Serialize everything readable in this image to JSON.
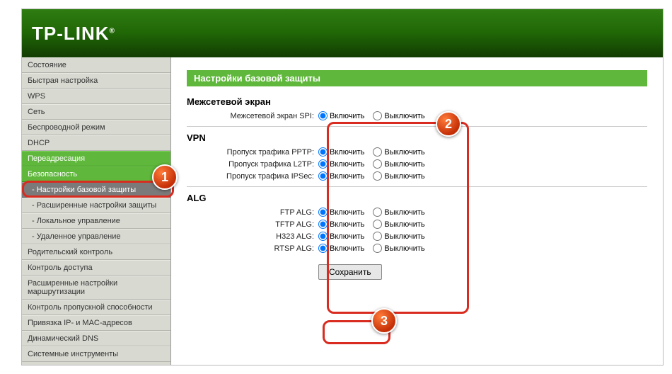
{
  "brand": "TP-LINK",
  "page_title": "Настройки базовой защиты",
  "nav": [
    {
      "label": "Состояние"
    },
    {
      "label": "Быстрая настройка"
    },
    {
      "label": "WPS"
    },
    {
      "label": "Сеть"
    },
    {
      "label": "Беспроводной режим"
    },
    {
      "label": "DHCP"
    },
    {
      "label": "Переадресация",
      "accent": true
    },
    {
      "label": "Безопасность",
      "accent": true
    },
    {
      "label": "- Настройки базовой защиты",
      "active": true,
      "sub": true
    },
    {
      "label": "- Расширенные настройки защиты",
      "sub": true
    },
    {
      "label": "- Локальное управление",
      "sub": true
    },
    {
      "label": "- Удаленное управление",
      "sub": true
    },
    {
      "label": "Родительский контроль"
    },
    {
      "label": "Контроль доступа"
    },
    {
      "label": "Расширенные настройки маршрутизации"
    },
    {
      "label": "Контроль пропускной способности"
    },
    {
      "label": "Привязка IP- и MAC-адресов"
    },
    {
      "label": "Динамический DNS"
    },
    {
      "label": "Системные инструменты"
    }
  ],
  "options": {
    "enable": "Включить",
    "disable": "Выключить"
  },
  "sections": {
    "firewall": {
      "title": "Межсетевой экран",
      "rows": [
        {
          "label": "Межсетевой экран SPI:"
        }
      ]
    },
    "vpn": {
      "title": "VPN",
      "rows": [
        {
          "label": "Пропуск трафика PPTP:"
        },
        {
          "label": "Пропуск трафика L2TP:"
        },
        {
          "label": "Пропуск трафика IPSec:"
        }
      ]
    },
    "alg": {
      "title": "ALG",
      "rows": [
        {
          "label": "FTP ALG:"
        },
        {
          "label": "TFTP ALG:"
        },
        {
          "label": "H323 ALG:"
        },
        {
          "label": "RTSP ALG:"
        }
      ]
    }
  },
  "save_label": "Сохранить",
  "badges": {
    "1": "1",
    "2": "2",
    "3": "3"
  }
}
